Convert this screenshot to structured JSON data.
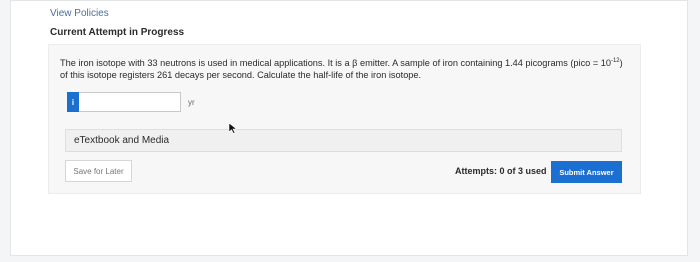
{
  "header": {
    "view_policies": "View Policies",
    "attempt_status": "Current Attempt in Progress"
  },
  "question": {
    "text_part1": "The iron isotope with 33 neutrons is used in medical applications. It is a β emitter. A sample of iron containing 1.44 picograms (pico = 10",
    "exponent": "-12",
    "text_part2": ") of this isotope registers 261 decays per second. Calculate the half-life of the iron isotope."
  },
  "answer": {
    "info_icon": "i",
    "value": "",
    "unit": "yr"
  },
  "etextbook_label": "eTextbook and Media",
  "footer": {
    "save_label": "Save for Later",
    "attempts_text": "Attempts: 0 of 3 used",
    "submit_label": "Submit Answer"
  },
  "colors": {
    "accent": "#1b6fd1",
    "link": "#4a6f96"
  }
}
